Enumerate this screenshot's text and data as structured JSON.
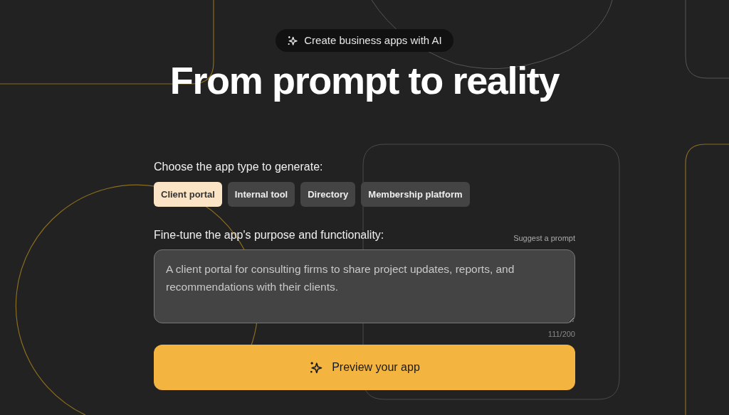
{
  "badge": {
    "text": "Create business apps with AI"
  },
  "title": "From prompt to reality",
  "app_type": {
    "label": "Choose the app type to generate:",
    "options": [
      {
        "label": "Client portal",
        "selected": true
      },
      {
        "label": "Internal tool",
        "selected": false
      },
      {
        "label": "Directory",
        "selected": false
      },
      {
        "label": "Membership platform",
        "selected": false
      }
    ]
  },
  "purpose": {
    "label": "Fine-tune the app's purpose and functionality:",
    "suggest_link": "Suggest a prompt",
    "value": "A client portal for consulting firms to share project updates, reports, and recommendations with their clients.",
    "counter": "111/200"
  },
  "submit_button": "Preview your app"
}
